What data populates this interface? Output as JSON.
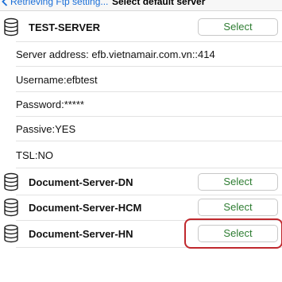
{
  "navbar": {
    "back_label": "Retrieving Ftp setting...",
    "title": "Select default server"
  },
  "expanded_server": {
    "name": "TEST-SERVER",
    "select_label": "Select",
    "details": [
      "Server address: efb.vietnamair.com.vn::414",
      "Username:efbtest",
      "Password:*****",
      "Passive:YES",
      "TSL:NO"
    ]
  },
  "servers": [
    {
      "name": "Document-Server-DN",
      "select_label": "Select"
    },
    {
      "name": "Document-Server-HCM",
      "select_label": "Select"
    },
    {
      "name": "Document-Server-HN",
      "select_label": "Select"
    }
  ],
  "colors": {
    "accent_link": "#1a6fd8",
    "select_text": "#2e7d32",
    "highlight_outline": "#c0282d"
  }
}
